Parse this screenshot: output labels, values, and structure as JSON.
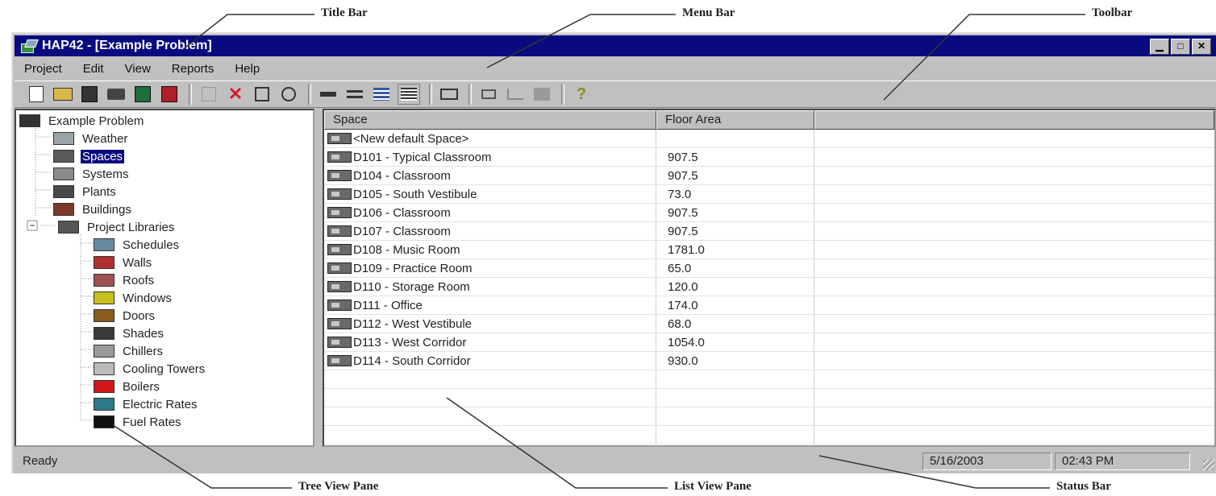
{
  "annotations": {
    "title_bar": "Title Bar",
    "menu_bar": "Menu Bar",
    "toolbar": "Toolbar",
    "tree_view_pane": "Tree View Pane",
    "list_view_pane": "List View Pane",
    "status_bar": "Status Bar"
  },
  "window": {
    "title": "HAP42 - [Example Problem]",
    "title_bar_color": "#0a0a80",
    "chrome_color": "#c0c0c0",
    "buttons": [
      "minimize-icon",
      "maximize-icon",
      "close-icon"
    ]
  },
  "menu": {
    "items": [
      "Project",
      "Edit",
      "View",
      "Reports",
      "Help"
    ]
  },
  "toolbar": {
    "buttons": [
      "new-icon",
      "open-icon",
      "save-icon",
      "library-icon",
      "save-green-icon",
      "save-red-icon",
      "copy-icon",
      "delete-icon",
      "properties-icon",
      "refresh-icon",
      "large-icons-icon",
      "small-icons-icon",
      "list-icon",
      "details-icon",
      "report-icon",
      "print-icon",
      "chart-icon",
      "graph-icon",
      "help-icon"
    ]
  },
  "tree": {
    "items": [
      {
        "label": "Example Problem",
        "icon": "project-icon",
        "color": "#333333"
      },
      {
        "label": "Weather",
        "icon": "weather-icon",
        "color": "#9aa4a8"
      },
      {
        "label": "Spaces",
        "icon": "spaces-icon",
        "color": "#5a5a5a",
        "selected": true
      },
      {
        "label": "Systems",
        "icon": "systems-icon",
        "color": "#8a8a8a"
      },
      {
        "label": "Plants",
        "icon": "plants-icon",
        "color": "#4a4a4a"
      },
      {
        "label": "Buildings",
        "icon": "buildings-icon",
        "color": "#7a3a2a"
      },
      {
        "label": "Project Libraries",
        "icon": "libraries-icon",
        "color": "#555555"
      },
      {
        "label": "Schedules",
        "icon": "schedules-icon",
        "color": "#6a8aa0"
      },
      {
        "label": "Walls",
        "icon": "walls-icon",
        "color": "#b03030"
      },
      {
        "label": "Roofs",
        "icon": "roofs-icon",
        "color": "#a05050"
      },
      {
        "label": "Windows",
        "icon": "windows-icon",
        "color": "#c8c020"
      },
      {
        "label": "Doors",
        "icon": "doors-icon",
        "color": "#8a5a20"
      },
      {
        "label": "Shades",
        "icon": "shades-icon",
        "color": "#3a3a3a"
      },
      {
        "label": "Chillers",
        "icon": "chillers-icon",
        "color": "#9a9a9a"
      },
      {
        "label": "Cooling Towers",
        "icon": "cooling-towers-icon",
        "color": "#bababa"
      },
      {
        "label": "Boilers",
        "icon": "boilers-icon",
        "color": "#d01818"
      },
      {
        "label": "Electric Rates",
        "icon": "electric-rates-icon",
        "color": "#2a7a8a"
      },
      {
        "label": "Fuel Rates",
        "icon": "fuel-rates-icon",
        "color": "#111111"
      }
    ]
  },
  "list": {
    "columns": [
      "Space",
      "Floor Area"
    ],
    "rows": [
      {
        "space": "<New default Space>",
        "area": ""
      },
      {
        "space": "D101 - Typical Classroom",
        "area": "907.5"
      },
      {
        "space": "D104 - Classroom",
        "area": "907.5"
      },
      {
        "space": "D105 - South Vestibule",
        "area": "73.0"
      },
      {
        "space": "D106 - Classroom",
        "area": "907.5"
      },
      {
        "space": "D107 - Classroom",
        "area": "907.5"
      },
      {
        "space": "D108 - Music Room",
        "area": "1781.0"
      },
      {
        "space": "D109 - Practice Room",
        "area": "65.0"
      },
      {
        "space": "D110 - Storage Room",
        "area": "120.0"
      },
      {
        "space": "D111 - Office",
        "area": "174.0"
      },
      {
        "space": "D112 - West Vestibule",
        "area": "68.0"
      },
      {
        "space": "D113 - West Corridor",
        "area": "1054.0"
      },
      {
        "space": "D114 - South Corridor",
        "area": "930.0"
      }
    ]
  },
  "status": {
    "text": "Ready",
    "date": "5/16/2003",
    "time": "02:43 PM"
  }
}
